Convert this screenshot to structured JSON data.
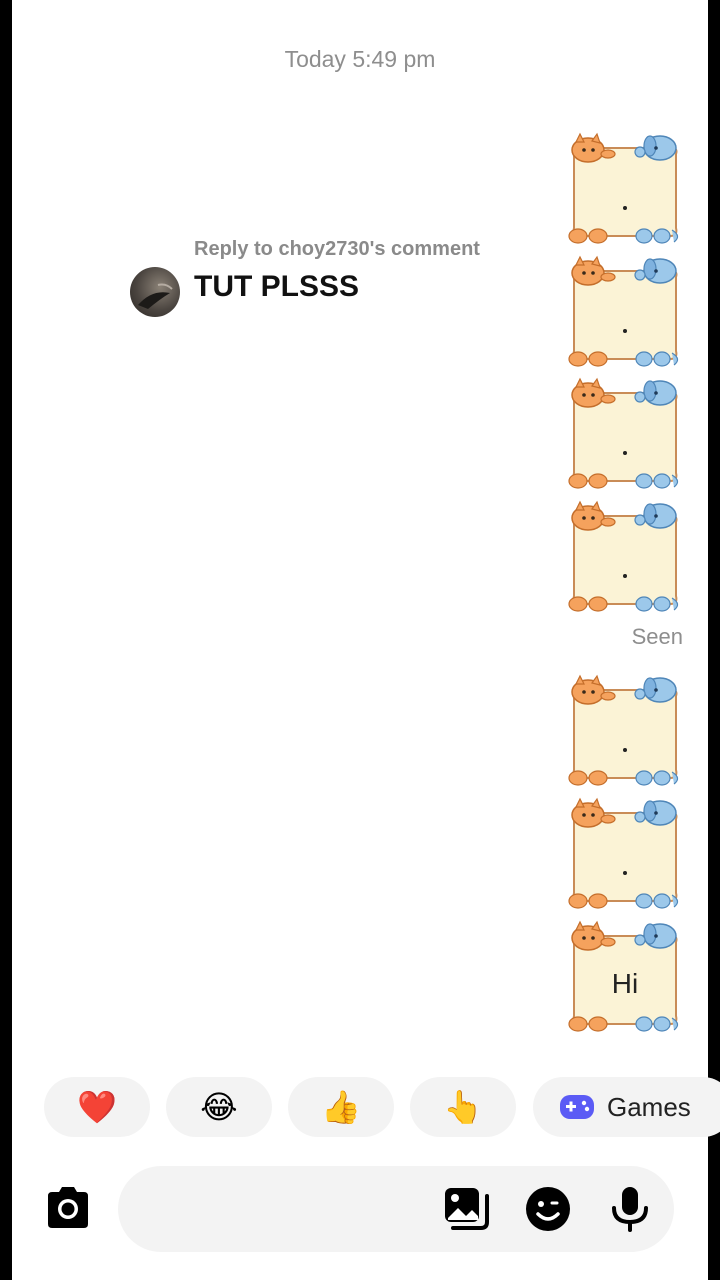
{
  "thread": {
    "timestamp": "Today 5:49 pm"
  },
  "incoming": {
    "reply_label": "Reply to choy2730's comment",
    "text": "TUT PLSSS"
  },
  "outgoing_stickers": [
    {
      "text": "."
    },
    {
      "text": "."
    },
    {
      "text": "."
    },
    {
      "text": "."
    },
    {
      "text": "."
    },
    {
      "text": "."
    },
    {
      "text": "Hi"
    }
  ],
  "status": {
    "seen": "Seen"
  },
  "quick_reactions": [
    {
      "emoji": "❤️",
      "icon": "red-heart"
    },
    {
      "emoji": "😂",
      "icon": "face-with-tears-of-joy"
    },
    {
      "emoji": "👍",
      "icon": "thumbs-up"
    },
    {
      "emoji": "👆",
      "icon": "pointing-up"
    }
  ],
  "games": {
    "label": "Games",
    "icon": "gamepad-icon",
    "color": "#5b5bf5"
  },
  "composer": {
    "placeholder": "",
    "icons": [
      "camera-icon",
      "gallery-icon",
      "sticker-icon",
      "microphone-icon"
    ]
  },
  "colors": {
    "sticker_bg": "#fbf3d6",
    "sticker_border": "#c98c57",
    "cat_orange": "#f5a25d",
    "dog_blue": "#9cc8ea",
    "secondary_text": "#8e8e8e"
  }
}
